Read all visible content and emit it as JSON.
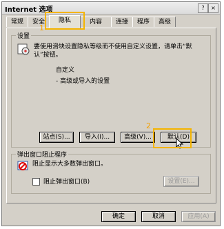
{
  "window": {
    "title": "Internet 选项",
    "help": "?",
    "close": "×"
  },
  "tabs": [
    {
      "label": "常规"
    },
    {
      "label": "安全"
    },
    {
      "label": "隐私"
    },
    {
      "label": "内容"
    },
    {
      "label": "连接"
    },
    {
      "label": "程序"
    },
    {
      "label": "高级"
    }
  ],
  "settings": {
    "group_title": "设置",
    "description": "要使用滑块设置隐私等级而不使用自定义设置，请单击“默认”按钮。",
    "level_title": "自定义",
    "level_detail": "- 高级或导入的设置",
    "buttons": {
      "sites": "站点(S)...",
      "import": "导入(I)...",
      "advanced": "高级(V)...",
      "default": "默认(D)"
    }
  },
  "popup": {
    "group_title": "弹出窗口阻止程序",
    "description": "阻止显示大多数弹出窗口。",
    "checkbox_label": "阻止弹出窗口(B)",
    "checkbox_checked": false,
    "settings_button": "设置(E)..."
  },
  "footer": {
    "ok": "确定",
    "cancel": "取消",
    "apply": "应用(A)"
  },
  "annotations": {
    "step1": "1",
    "step2": "2",
    "highlight_color": "#f4b400"
  }
}
